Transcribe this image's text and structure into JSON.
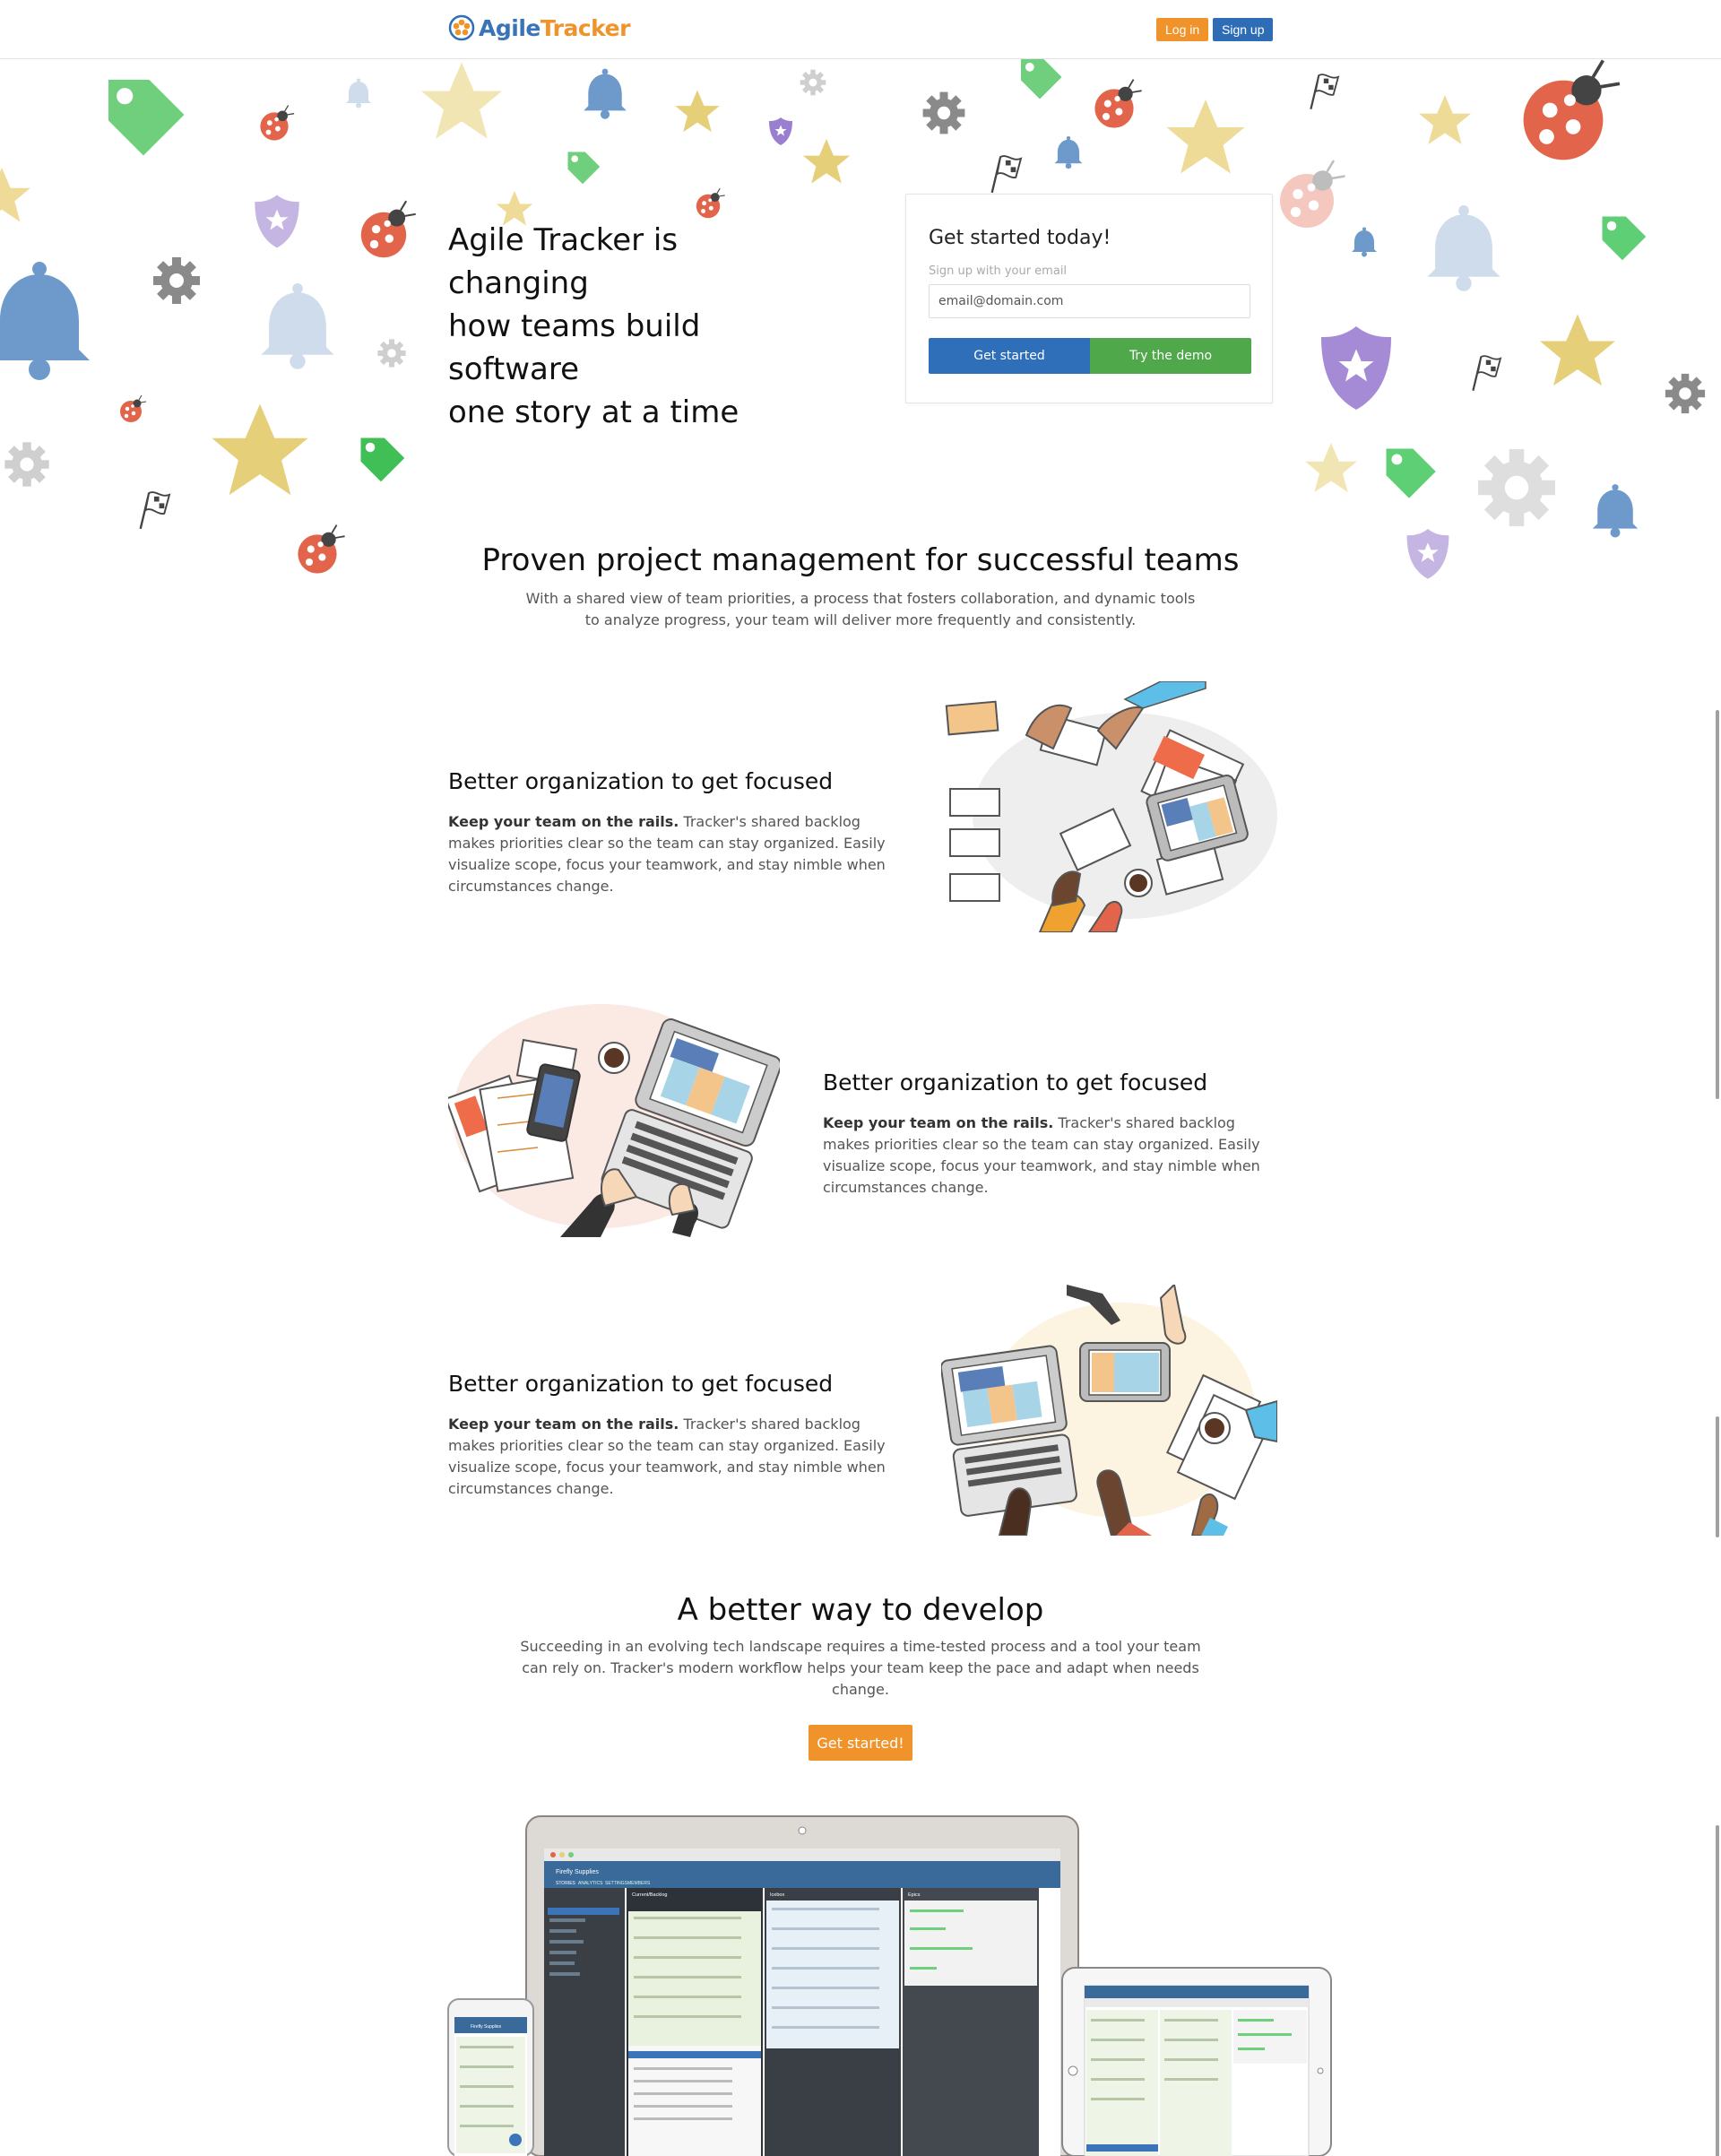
{
  "header": {
    "logo_agile": "Agile",
    "logo_tracker": "Tracker",
    "login_label": "Log in",
    "signup_label": "Sign up"
  },
  "hero": {
    "headline_line1": "Agile Tracker is changing",
    "headline_line2": "how teams build software",
    "headline_line3": "one story at a time",
    "card": {
      "title": "Get started today!",
      "label": "Sign up with your email",
      "email_placeholder": "email@domain.com",
      "get_started_label": "Get started",
      "demo_label": "Try the demo"
    }
  },
  "proven": {
    "title": "Proven project management for successful teams",
    "subtitle": "With a shared view of team priorities, a process that fosters collaboration, and dynamic tools to analyze progress, your team will deliver more frequently and consistently."
  },
  "features": [
    {
      "title": "Better organization to get focused",
      "lead": "Keep your team on the rails.",
      "body": " Tracker's shared backlog makes priorities clear so the team can stay organized. Easily visualize scope, focus your teamwork, and stay nimble when circumstances change."
    },
    {
      "title": "Better organization to get focused",
      "lead": "Keep your team on the rails.",
      "body": " Tracker's shared backlog makes priorities clear so the team can stay organized. Easily visualize scope, focus your teamwork, and stay nimble when circumstances change."
    },
    {
      "title": "Better organization to get focused",
      "lead": "Keep your team on the rails.",
      "body": " Tracker's shared backlog makes priorities clear so the team can stay organized. Easily visualize scope, focus your teamwork, and stay nimble when circumstances change."
    }
  ],
  "better": {
    "title": "A better way to develop",
    "subtitle": "Succeeding in an evolving tech landscape requires a time-tested process and a tool your team can rely on. Tracker's modern workflow helps your team keep the pace and adapt when needs change.",
    "cta_label": "Get started!"
  },
  "device_preview": {
    "app_project": "Firefly Supplies",
    "tab_stories": "STORIES",
    "tab_analytics": "ANALYTICS",
    "tab_settings": "SETTINGS",
    "tab_members": "MEMBERS",
    "panel_current": "Current/Backlog",
    "panel_icebox": "Icebox",
    "panel_epics": "Epics",
    "mobile_project": "Firefly Supplies"
  },
  "colors": {
    "brand_blue": "#2f6fba",
    "brand_orange": "#f0932b",
    "brand_green": "#4fa84a"
  }
}
